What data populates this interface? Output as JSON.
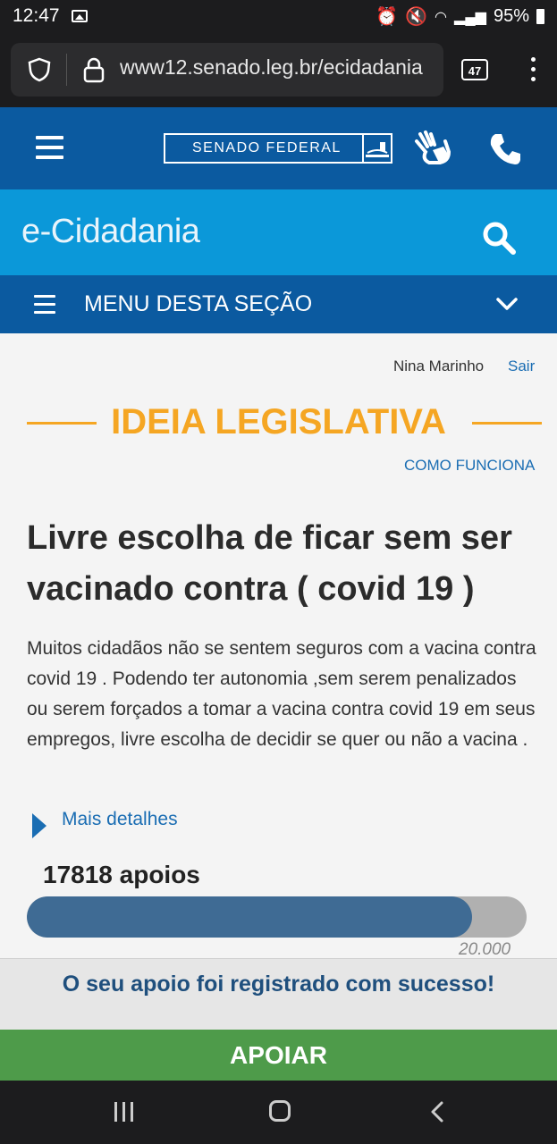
{
  "status_bar": {
    "time": "12:47",
    "battery": "95%"
  },
  "browser": {
    "url": "www12.senado.leg.br/ecidadania",
    "tab_count": "47"
  },
  "header": {
    "brand": "SENADO FEDERAL"
  },
  "site": {
    "title": "e-Cidadania"
  },
  "menu": {
    "label": "MENU DESTA SEÇÃO"
  },
  "user": {
    "name": "Nina Marinho",
    "logout": "Sair"
  },
  "section": {
    "title": "IDEIA LEGISLATIVA",
    "how_it_works": "COMO FUNCIONA"
  },
  "idea": {
    "title": "Livre escolha de ficar sem ser vacinado contra ( covid 19 )",
    "description": "Muitos cidadãos não se sentem seguros com a vacina contra covid 19 . Podendo ter autonomia ,sem serem penalizados ou serem forçados a tomar a vacina contra covid 19 em seus empregos, livre escolha de decidir se quer ou não a vacina .",
    "more_details": "Mais detalhes",
    "supports_label": "17818 apoios",
    "supports": 17818,
    "goal_label": "20.000",
    "goal": 20000
  },
  "notification": {
    "message": "O seu apoio foi registrado com sucesso!"
  },
  "action": {
    "support_button": "APOIAR"
  },
  "colors": {
    "header_blue": "#0b5aa0",
    "ecidadania_blue": "#0b98d9",
    "accent_orange": "#f5a623",
    "progress_fill": "#3f6b94",
    "button_green": "#4e9b4a"
  }
}
